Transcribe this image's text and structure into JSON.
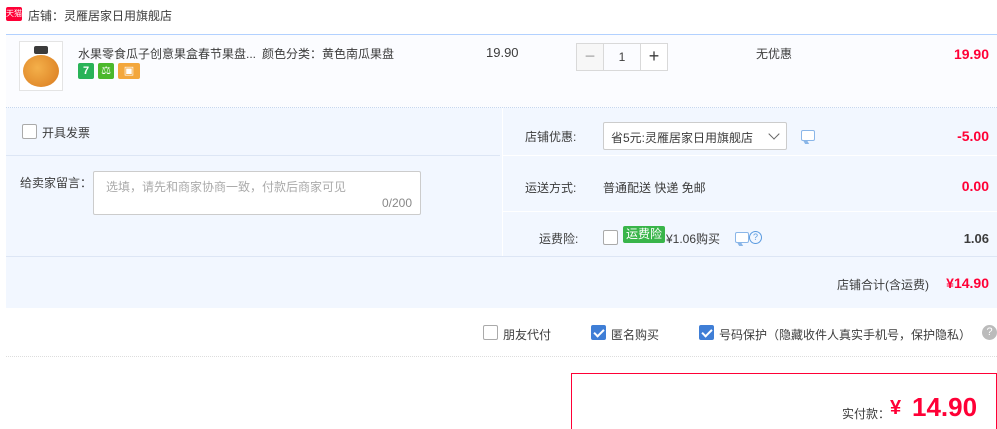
{
  "shop": {
    "badge": "天猫",
    "title": "店铺：灵雁居家日用旗舰店"
  },
  "item": {
    "name": "水果零食瓜子创意果盒春节果盘...",
    "sku": "颜色分类：黄色南瓜果盘",
    "services": [
      "7",
      "⚖",
      "▣"
    ],
    "unit_price": "19.90",
    "qty": {
      "minus": "−",
      "value": "1",
      "plus": "+"
    },
    "promo": "无优惠",
    "total": "19.90"
  },
  "invoice": {
    "label": "开具发票",
    "checked": false
  },
  "message": {
    "label": "给卖家留言：",
    "placeholder": "选填，请先和商家协商一致，付款后商家可见",
    "count": "0/200"
  },
  "coupon": {
    "label": "店铺优惠:",
    "selected": "省5元:灵雁居家日用旗舰店",
    "amount": "-5.00"
  },
  "shipping": {
    "label": "运送方式:",
    "value": "普通配送 快递 免邮",
    "amount": "0.00"
  },
  "insurance": {
    "label": "运费险:",
    "badge": "运费险",
    "text": "¥1.06购买",
    "amount": "1.06",
    "checked": false,
    "help": "?"
  },
  "shop_total": {
    "label": "店铺合计(含运费)",
    "amount": "¥14.90"
  },
  "privacy": {
    "friend_pay": {
      "label": "朋友代付",
      "checked": false
    },
    "anonymous": {
      "label": "匿名购买",
      "checked": true
    },
    "number_protect": {
      "label": "号码保护（隐藏收件人真实手机号，保护隐私）",
      "checked": true
    },
    "help": "?"
  },
  "pay": {
    "label": "实付款：",
    "yen": "¥",
    "amount": "14.90"
  },
  "colors": {
    "accent": "#ff0036",
    "blue_check": "#3f7ed6",
    "panel": "#f2f7ff"
  }
}
